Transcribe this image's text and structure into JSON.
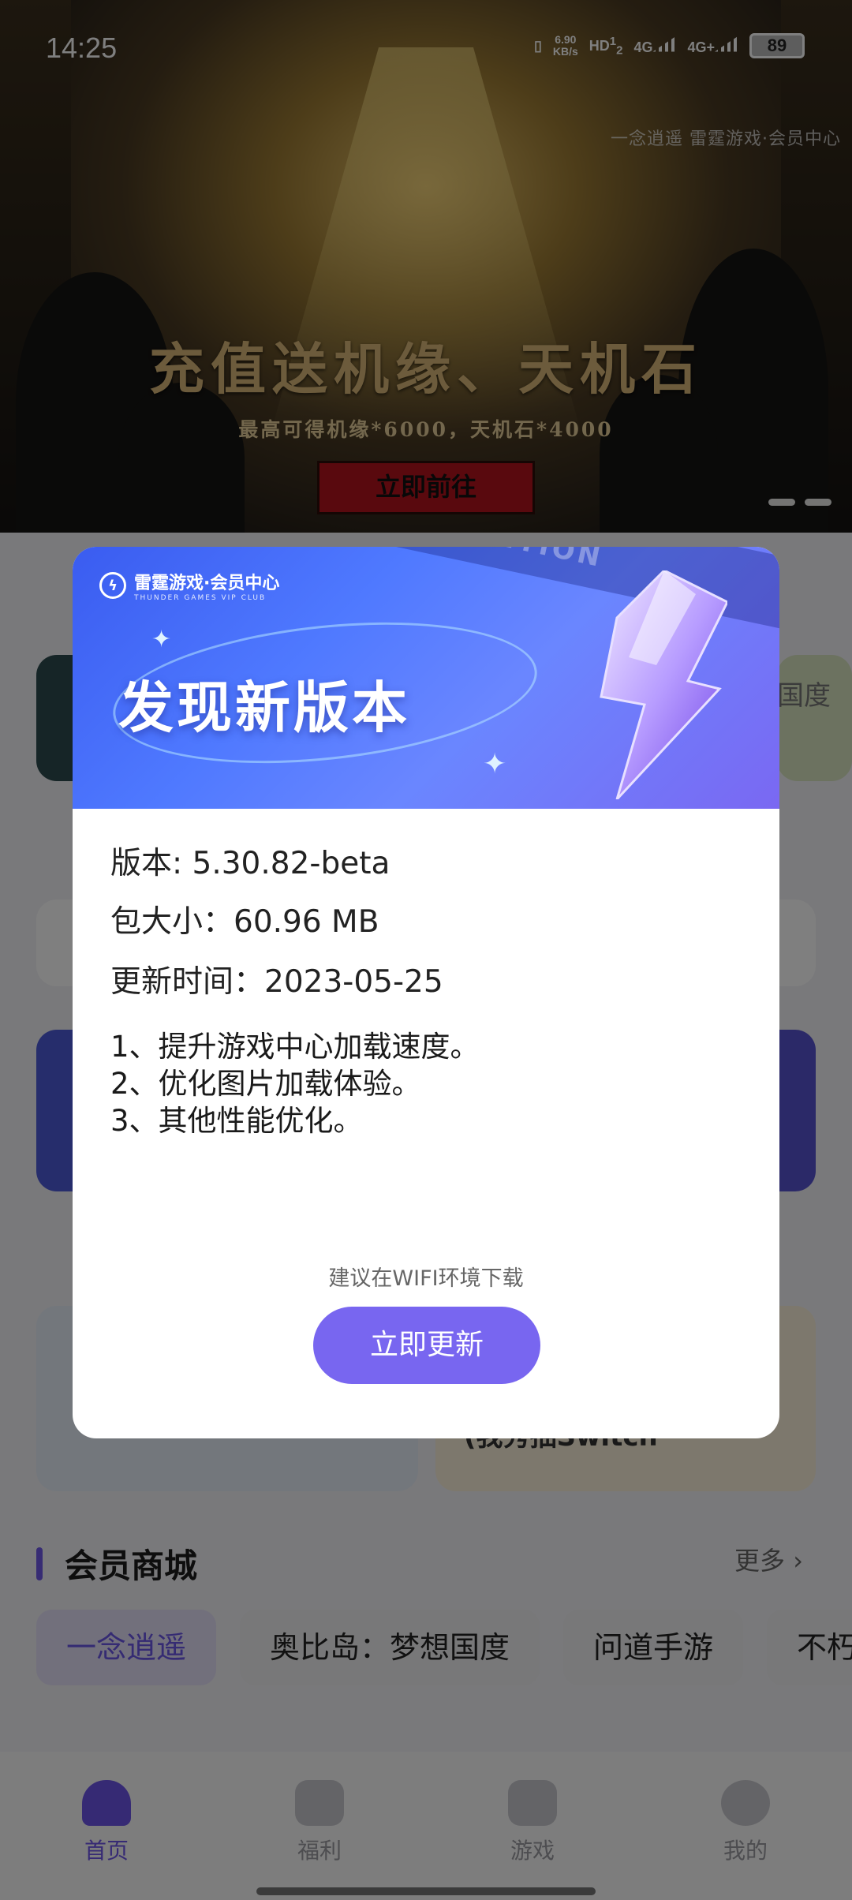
{
  "status_bar": {
    "time": "14:25",
    "net_speed_value": "6.90",
    "net_speed_unit": "KB/s",
    "hd_label": "HD",
    "sim1": "1",
    "sim2": "2",
    "net1": "4G",
    "net2": "4G+",
    "battery": "89"
  },
  "banner": {
    "brand_game": "一念逍遥",
    "brand_platform": "雷霆游戏·会员中心",
    "title": "充值送机缘、天机石",
    "subtitle": "最高可得机缘*6000，天机石*4000",
    "button": "立即前往"
  },
  "background": {
    "shop_title": "会员商城",
    "shop_more": "更多",
    "shop_tabs": [
      "一念逍遥",
      "奥比岛：梦想国度",
      "问道手游",
      "不朽"
    ],
    "peek_text_1": "国度",
    "peek_text_2": "(我秀抽Switch"
  },
  "dialog": {
    "brand": "雷霆游戏·会员中心",
    "brand_sub": "THUNDER GAMES VIP CLUB",
    "header_bg_text": "EXTENTION",
    "title": "发现新版本",
    "version_line": "版本: 5.30.82-beta",
    "size_line": "包大小：60.96 MB",
    "date_line": "更新时间：2023-05-25",
    "notes": [
      "1、提升游戏中心加载速度。",
      "2、优化图片加载体验。",
      "3、其他性能优化。"
    ],
    "hint": "建议在WIFI环境下载",
    "update_button": "立即更新"
  },
  "tabbar": {
    "items": [
      {
        "label": "首页",
        "icon": "home-icon"
      },
      {
        "label": "福利",
        "icon": "gift-icon"
      },
      {
        "label": "游戏",
        "icon": "gamepad-icon"
      },
      {
        "label": "我的",
        "icon": "profile-icon"
      }
    ],
    "active_index": 0
  },
  "colors": {
    "accent": "#6d55e8",
    "update_button": "#7866f0",
    "dialog_header": "#4f79ff"
  }
}
